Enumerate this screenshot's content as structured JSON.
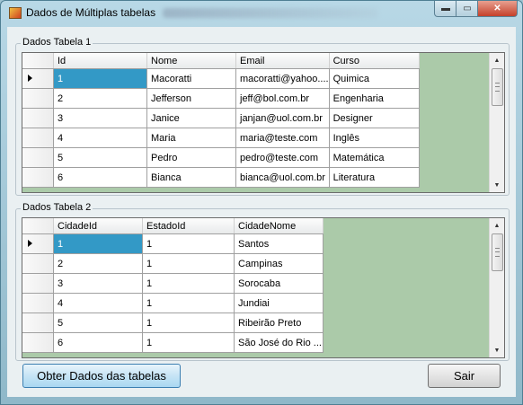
{
  "window": {
    "title": "Dados de Múltiplas tabelas",
    "controls": {
      "minimize": "▬",
      "maximize": "▭",
      "close": "✕"
    }
  },
  "group1": {
    "label": "Dados Tabela 1",
    "columns": [
      "Id",
      "Nome",
      "Email",
      "Curso"
    ],
    "rows": [
      [
        "1",
        "Macoratti",
        "macoratti@yahoo....",
        "Quimica"
      ],
      [
        "2",
        "Jefferson",
        "jeff@bol.com.br",
        "Engenharia"
      ],
      [
        "3",
        "Janice",
        "janjan@uol.com.br",
        "Designer"
      ],
      [
        "4",
        "Maria",
        "maria@teste.com",
        "Inglês"
      ],
      [
        "5",
        "Pedro",
        "pedro@teste.com",
        "Matemática"
      ],
      [
        "6",
        "Bianca",
        "bianca@uol.com.br",
        "Literatura"
      ]
    ]
  },
  "group2": {
    "label": "Dados Tabela 2",
    "columns": [
      "CidadeId",
      "EstadoId",
      "CidadeNome"
    ],
    "rows": [
      [
        "1",
        "1",
        "Santos"
      ],
      [
        "2",
        "1",
        "Campinas"
      ],
      [
        "3",
        "1",
        "Sorocaba"
      ],
      [
        "4",
        "1",
        "Jundiai"
      ],
      [
        "5",
        "1",
        "Ribeirão Preto"
      ],
      [
        "6",
        "1",
        "São José do Rio ..."
      ]
    ]
  },
  "buttons": {
    "fetch": "Obter Dados das tabelas",
    "exit": "Sair"
  },
  "colors": {
    "selected_cell": "#3399c6",
    "grid_background": "#abcaa9"
  }
}
